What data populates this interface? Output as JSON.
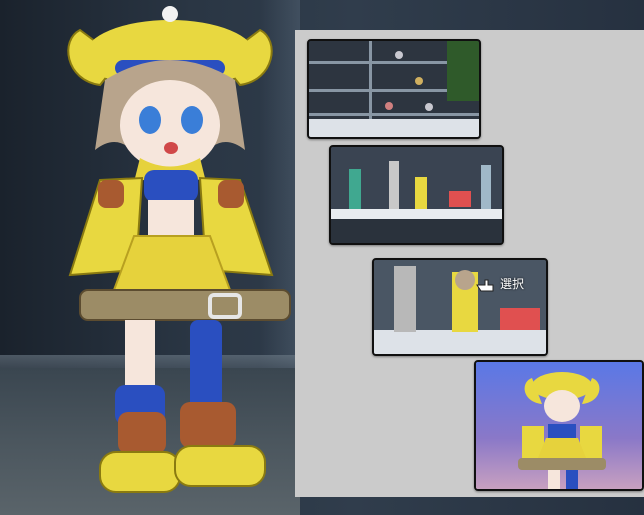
{
  "scene": {
    "figure_colors": {
      "hat": "#e8d840",
      "hat_band": "#2a4fc0",
      "hair": "#b8a48c",
      "skin": "#f6e6dc",
      "top": "#2a4fc0",
      "skirt": "#e6d23c",
      "belt": "#9c8c66",
      "boots": "#e8d840",
      "gloves": "#e8d840",
      "leg_armor": "#2a4fc0",
      "cuffs": "#a85a30"
    }
  },
  "panel": {
    "background": "#cbcbcb",
    "thumbnails": [
      {
        "name": "display-case-overview"
      },
      {
        "name": "shelf-closeup"
      },
      {
        "name": "figure-selection",
        "label": "選択",
        "icon": "pointing-hand-icon"
      },
      {
        "name": "selected-figure-preview"
      }
    ]
  }
}
